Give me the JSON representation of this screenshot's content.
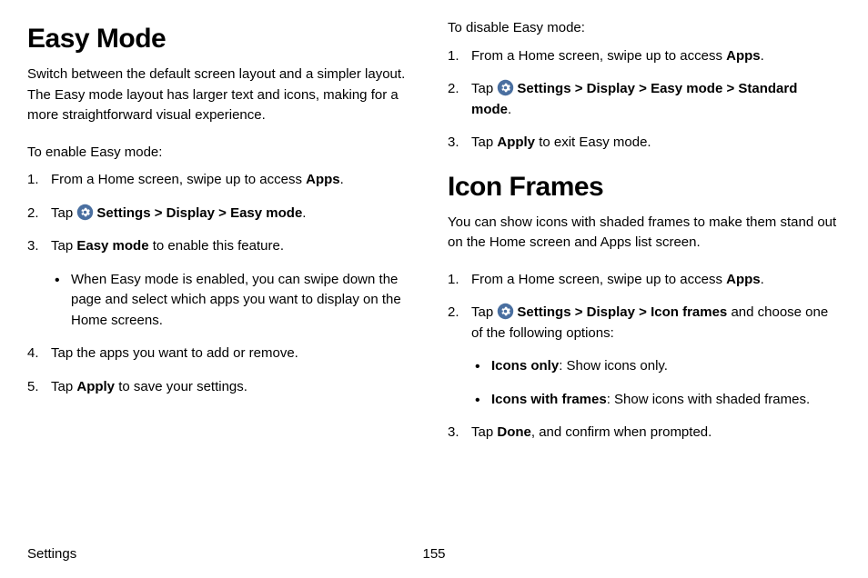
{
  "col1": {
    "heading": "Easy Mode",
    "intro": "Switch between the default screen layout and a simpler layout. The Easy mode layout has larger text and icons, making for a more straightforward visual experience.",
    "enable_lead": "To enable Easy mode:",
    "enable_steps": {
      "s1_prefix": "From a Home screen, swipe up to access ",
      "s1_bold": "Apps",
      "s1_suffix": ".",
      "s2_prefix": "Tap ",
      "s2_bold": "Settings > Display > Easy mode",
      "s2_suffix": ".",
      "s3_prefix": "Tap ",
      "s3_bold": "Easy mode",
      "s3_suffix": " to enable this feature.",
      "s3_sub": "When Easy mode is enabled, you can swipe down the page and select which apps you want to display on the Home screens.",
      "s4": "Tap the apps you want to add or remove.",
      "s5_prefix": "Tap ",
      "s5_bold": "Apply",
      "s5_suffix": " to save your settings."
    }
  },
  "col2": {
    "disable_lead": "To disable Easy mode:",
    "disable_steps": {
      "s1_prefix": "From a Home screen, swipe up to access ",
      "s1_bold": "Apps",
      "s1_suffix": ".",
      "s2_prefix": "Tap ",
      "s2_bold": "Settings > Display > Easy mode > Standard mode",
      "s2_suffix": ".",
      "s3_prefix": "Tap ",
      "s3_bold": "Apply",
      "s3_suffix": " to exit Easy mode."
    },
    "heading": "Icon Frames",
    "intro": "You can show icons with shaded frames to make them stand out on the Home screen and Apps list screen.",
    "steps": {
      "s1_prefix": "From a Home screen, swipe up to access ",
      "s1_bold": "Apps",
      "s1_suffix": ".",
      "s2_prefix": "Tap ",
      "s2_bold": "Settings > Display > Icon frames",
      "s2_suffix": " and choose one of the following options:",
      "s2_sub1_bold": "Icons only",
      "s2_sub1_text": ": Show icons only.",
      "s2_sub2_bold": "Icons with frames",
      "s2_sub2_text": ": Show icons with shaded frames.",
      "s3_prefix": "Tap ",
      "s3_bold": "Done",
      "s3_suffix": ", and confirm when prompted."
    }
  },
  "footer": {
    "label": "Settings",
    "page": "155"
  }
}
